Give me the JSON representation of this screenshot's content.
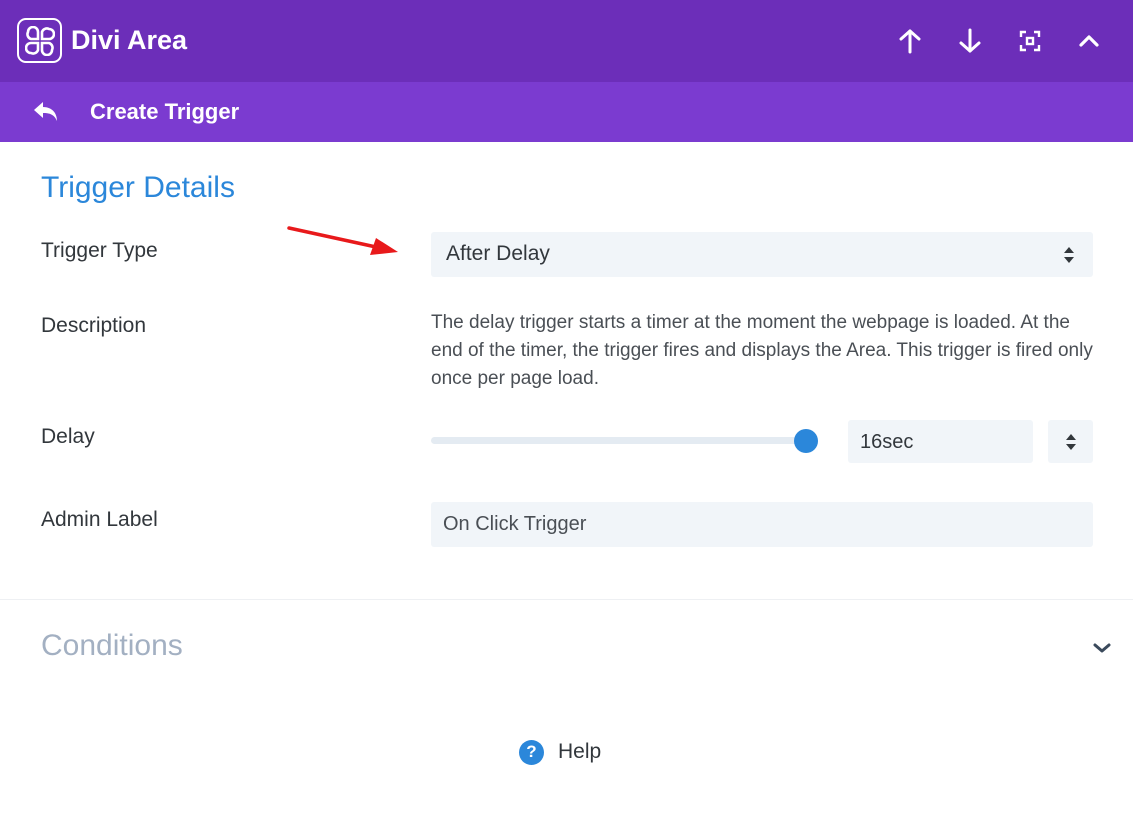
{
  "header": {
    "app_title": "Divi Area",
    "icons": [
      "logo-icon",
      "arrow-up-icon",
      "arrow-down-icon",
      "fullscreen-icon",
      "collapse-icon"
    ]
  },
  "subheader": {
    "title": "Create Trigger",
    "back_icon": "back-icon"
  },
  "trigger_details": {
    "section_title": "Trigger Details",
    "trigger_type": {
      "label": "Trigger Type",
      "value": "After Delay"
    },
    "description": {
      "label": "Description",
      "text": "The delay trigger starts a timer at the moment the webpage is loaded. At the end of the timer, the trigger fires and displays the Area. This trigger is fired only once per page load."
    },
    "delay": {
      "label": "Delay",
      "value": "16sec",
      "slider_level": 1.0
    },
    "admin_label": {
      "label": "Admin Label",
      "value": "On Click Trigger"
    }
  },
  "conditions": {
    "title": "Conditions"
  },
  "help": {
    "label": "Help",
    "icon": "question-icon"
  },
  "colors": {
    "header_bg": "#6c2eb9",
    "subheader_bg": "#7b3bd0",
    "accent": "#2b87da",
    "field_bg": "#f1f5f9",
    "annotation_arrow": "#e8191b"
  }
}
